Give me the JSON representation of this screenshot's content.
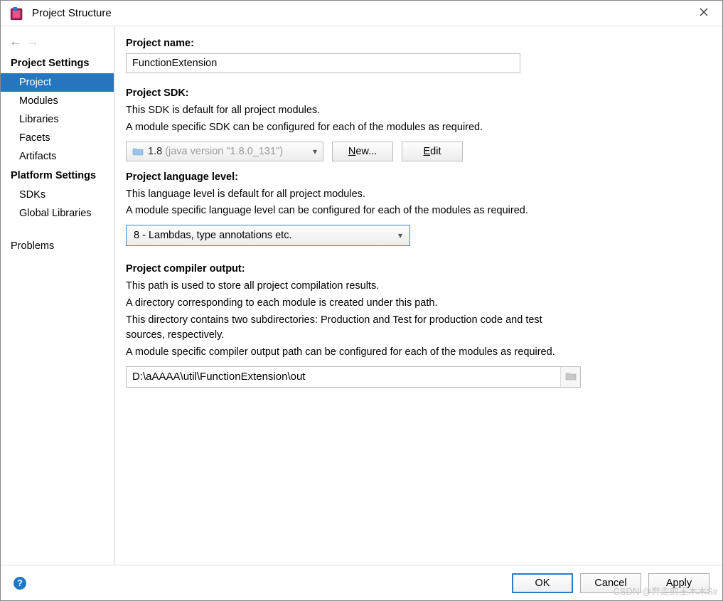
{
  "window": {
    "title": "Project Structure"
  },
  "sidebar": {
    "section1": "Project Settings",
    "items1": [
      {
        "label": "Project",
        "selected": true
      },
      {
        "label": "Modules"
      },
      {
        "label": "Libraries"
      },
      {
        "label": "Facets"
      },
      {
        "label": "Artifacts"
      }
    ],
    "section2": "Platform Settings",
    "items2": [
      {
        "label": "SDKs"
      },
      {
        "label": "Global Libraries"
      }
    ],
    "section3": "",
    "items3": [
      {
        "label": "Problems"
      }
    ]
  },
  "project": {
    "name_label": "Project name:",
    "name_value": "FunctionExtension",
    "sdk_label": "Project SDK:",
    "sdk_desc1": "This SDK is default for all project modules.",
    "sdk_desc2": "A module specific SDK can be configured for each of the modules as required.",
    "sdk_value": "1.8",
    "sdk_version_hint": "(java version \"1.8.0_131\")",
    "new_btn": "New...",
    "edit_btn": "Edit",
    "lang_label": "Project language level:",
    "lang_desc1": "This language level is default for all project modules.",
    "lang_desc2": "A module specific language level can be configured for each of the modules as required.",
    "lang_value": "8 - Lambdas, type annotations etc.",
    "out_label": "Project compiler output:",
    "out_desc1": "This path is used to store all project compilation results.",
    "out_desc2": "A directory corresponding to each module is created under this path.",
    "out_desc3": "This directory contains two subdirectories: Production and Test for production code and test sources, respectively.",
    "out_desc4": "A module specific compiler output path can be configured for each of the modules as required.",
    "out_value": "D:\\aAAAA\\util\\FunctionExtension\\out"
  },
  "footer": {
    "ok": "OK",
    "cancel": "Cancel",
    "apply": "Apply"
  },
  "watermark": "CSDN @奔走的王木木Sir"
}
